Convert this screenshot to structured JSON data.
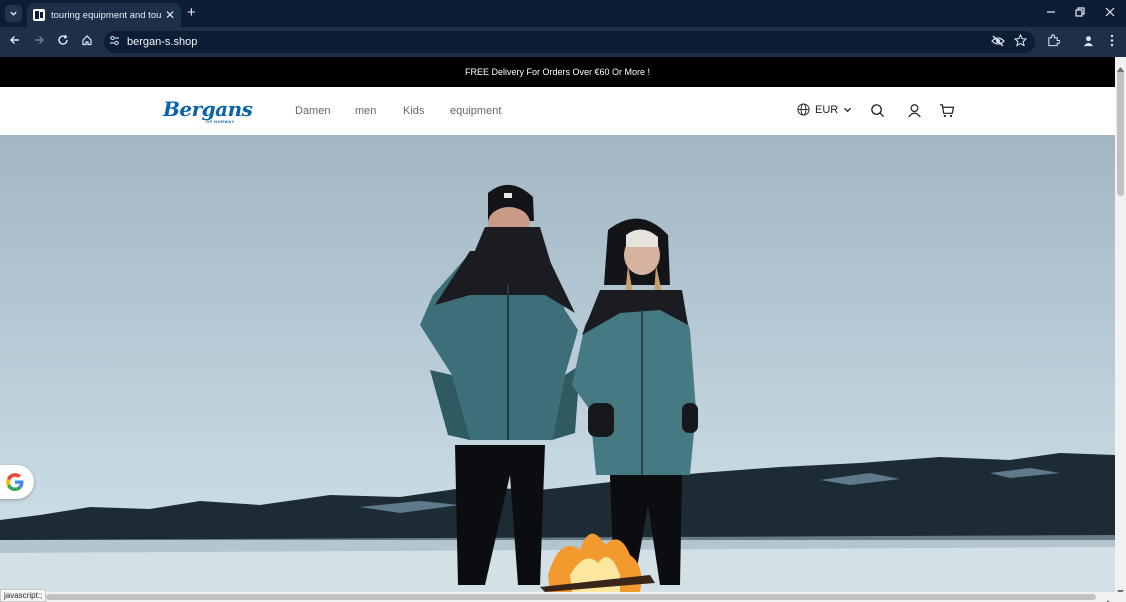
{
  "browser": {
    "tab_title": "touring equipment and touring",
    "new_tab_symbol": "+",
    "close_symbol": "✕",
    "url": "bergan-s.shop",
    "icons": [
      "tab-search-icon",
      "favicon-icon",
      "close-icon",
      "new-tab-icon",
      "minimize-icon",
      "restore-icon",
      "window-close-icon",
      "back-icon",
      "forward-icon",
      "reload-icon",
      "home-icon",
      "site-settings-icon",
      "eye-off-icon",
      "star-icon",
      "extensions-icon",
      "profile-icon",
      "menu-dots-icon"
    ]
  },
  "announcement": "FREE Delivery For Orders Over €60 Or More !",
  "header": {
    "logo_text": "Bergans",
    "logo_subtext": "OF NORWAY",
    "nav": [
      "Damen",
      "men",
      "Kids",
      "equipment"
    ],
    "currency": "EUR",
    "icons": [
      "globe-icon",
      "chevron-down-icon",
      "search-icon",
      "account-icon",
      "cart-icon"
    ]
  },
  "status_bar": "javascript:;",
  "colors": {
    "chrome_dark": "#0e1d36",
    "chrome_toolbar": "#1f2f4a",
    "announcement_bg": "#000000",
    "brand_blue": "#0a63a8",
    "jacket_teal": "#3d6f78"
  }
}
